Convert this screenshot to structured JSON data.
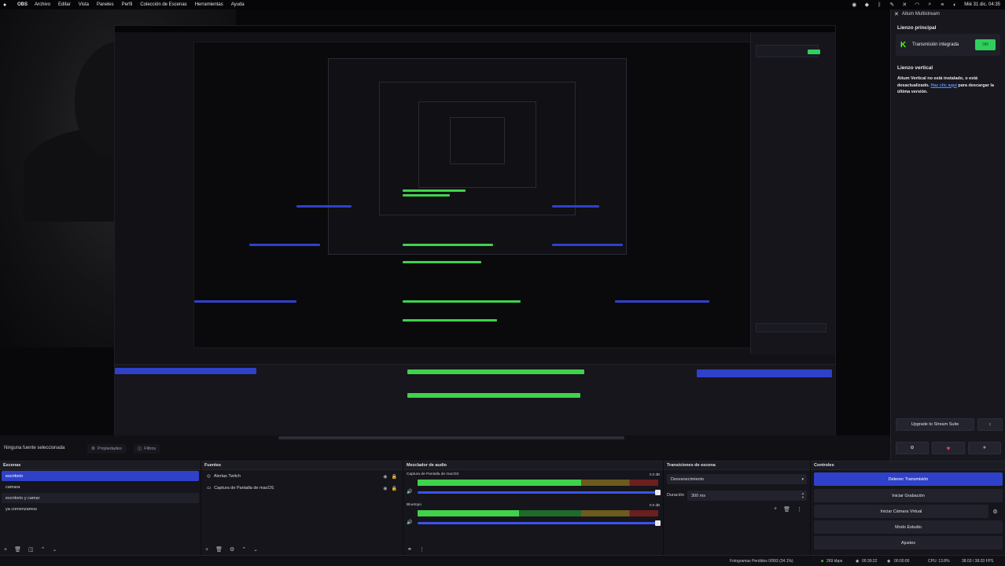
{
  "menubar": {
    "app": "OBS",
    "items": [
      "Archivo",
      "Editar",
      "Vista",
      "Paneles",
      "Perfil",
      "Colección de Escenas",
      "Herramientas",
      "Ayuda"
    ],
    "datetime": "Mié 31 dic. 04:35"
  },
  "multistream": {
    "title": "Aitum Multistream",
    "main_heading": "Lienzo principal",
    "platform": "Transmisión integrada",
    "toggle": "ON",
    "vertical_heading": "Lienzo vertical",
    "vertical_msg_1": "Aitum Vertical no está instalado, o está desactualizado.",
    "vertical_link": "Haz clic aquí",
    "vertical_msg_2": "para descargar la última versión.",
    "upgrade": "Upgrade to Stream Suite",
    "colors": {
      "kick": "#53fc18",
      "toggle": "#2ecf5c"
    }
  },
  "sourcebar": {
    "no_selection": "Ninguna fuente seleccionada",
    "properties": "Propiedades",
    "filters": "Filtros"
  },
  "scenes": {
    "title": "Escenas",
    "items": [
      "escritorio",
      "camara",
      "escritorio y camar",
      "ya comenzamos"
    ],
    "selected": 0
  },
  "sources": {
    "title": "Fuentes",
    "items": [
      "Alertas Twitch",
      "Captura de Pantalla de macOS"
    ]
  },
  "mixer": {
    "title": "Mezclador de audio",
    "channels": [
      {
        "name": "Captura de Pantalla de macOS",
        "db": "0.0 dB",
        "level": 0.68
      },
      {
        "name": "Bluetopo",
        "db": "0.0 dB",
        "level": 0.42
      }
    ]
  },
  "transitions": {
    "title": "Transiciones de escena",
    "selected": "Desvanecimiento",
    "duration_label": "Duración",
    "duration_value": "300 ms"
  },
  "controls": {
    "title": "Controles",
    "buttons": [
      "Detener Transmisión",
      "Iniciar Grabación",
      "Iniciar Cámara Virtual",
      "Modo Estudio",
      "Ajustes"
    ]
  },
  "status": {
    "frames": "Fotogramas Perdidos 0/993 (34.1%)",
    "bitrate": "269 kbps",
    "time_live": "00:39:22",
    "time_rec": "00:00:00",
    "cpu": "CPU: 13.8%",
    "fps": "38.03 / 38.03 FPS"
  }
}
